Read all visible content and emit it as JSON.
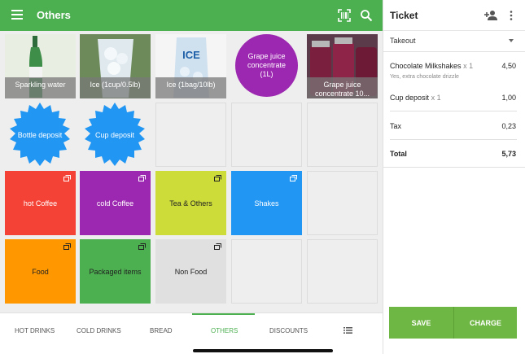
{
  "appbar": {
    "title": "Others",
    "menu_icon": "menu-icon",
    "scan_icon": "barcode-scan-icon",
    "search_icon": "search-icon"
  },
  "items": [
    {
      "label": "Sparkling water",
      "kind": "photo",
      "photo": "bottle"
    },
    {
      "label": "Ice (1cup/0.5lb)",
      "kind": "photo",
      "photo": "ice-cup"
    },
    {
      "label": "Ice (1bag/10lb)",
      "kind": "photo",
      "photo": "ice-bag",
      "bag_text": "ICE"
    },
    {
      "label": "Grape juice concentrate (1L)",
      "kind": "circle",
      "color": "#9c27b0"
    },
    {
      "label": "Grape juice concentrate 10...",
      "kind": "photo",
      "photo": "grape-jars"
    },
    {
      "label": "Bottle deposit",
      "kind": "badge",
      "color": "#2196f3"
    },
    {
      "label": "Cup deposit",
      "kind": "badge",
      "color": "#2196f3"
    }
  ],
  "categories": [
    {
      "label": "hot Coffee",
      "color": "#f44336",
      "text_color": "#ffffff"
    },
    {
      "label": "cold Coffee",
      "color": "#9c27b0",
      "text_color": "#ffffff"
    },
    {
      "label": "Tea & Others",
      "color": "#cddc39",
      "text_color": "#222222"
    },
    {
      "label": "Shakes",
      "color": "#2196f3",
      "text_color": "#ffffff"
    },
    {
      "label": "Food",
      "color": "#ff9800",
      "text_color": "#222222"
    },
    {
      "label": "Packaged items",
      "color": "#4caf50",
      "text_color": "#222222"
    },
    {
      "label": "Non Food",
      "color": "#e0e0e0",
      "text_color": "#222222"
    }
  ],
  "tabs": [
    "HOT DRINKS",
    "COLD DRINKS",
    "BREAD",
    "OTHERS",
    "DISCOUNTS"
  ],
  "active_tab": "OTHERS",
  "ticket": {
    "title": "Ticket",
    "add_customer_icon": "add-customer-icon",
    "more_icon": "more-vertical-icon",
    "dining_option": "Takeout",
    "lines": [
      {
        "name": "Chocolate Milkshakes",
        "qty": "x 1",
        "price": "4,50",
        "note": "Yes, extra chocolate drizzle"
      },
      {
        "name": "Cup deposit",
        "qty": "x 1",
        "price": "1,00"
      }
    ],
    "tax_label": "Tax",
    "tax_value": "0,23",
    "total_label": "Total",
    "total_value": "5,73",
    "save_label": "SAVE",
    "charge_label": "CHARGE"
  },
  "colors": {
    "brand": "#4caf50",
    "action": "#6fb744"
  }
}
